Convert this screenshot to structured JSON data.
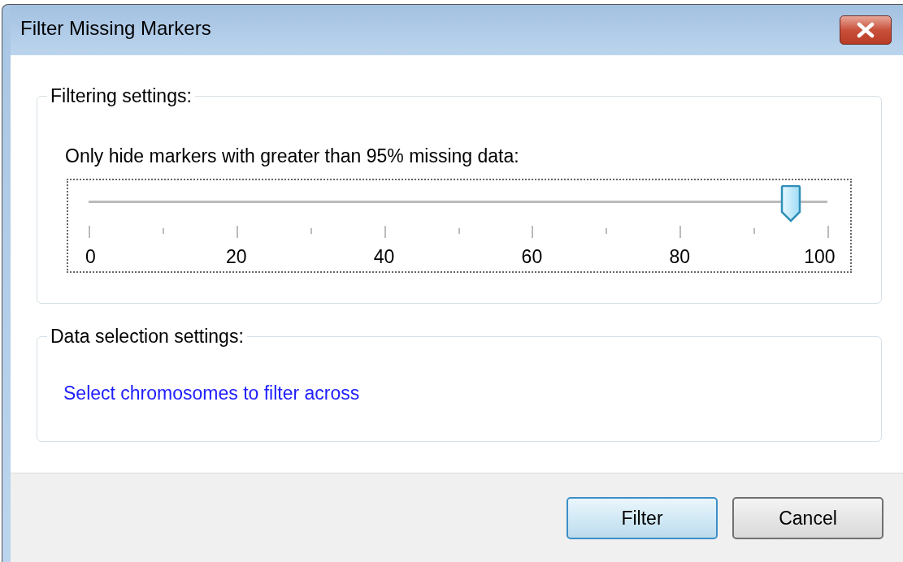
{
  "window": {
    "title": "Filter Missing Markers"
  },
  "filtering": {
    "legend": "Filtering settings:",
    "label": "Only hide markers with greater than 95% missing data:",
    "slider": {
      "level": 0.95,
      "labels": [
        "0",
        "20",
        "40",
        "60",
        "80",
        "100"
      ]
    }
  },
  "data_selection": {
    "legend": "Data selection settings:",
    "link": "Select chromosomes to filter across"
  },
  "buttons": [
    {
      "label": "Filter",
      "default": true
    },
    {
      "label": "Cancel",
      "default": false
    }
  ]
}
